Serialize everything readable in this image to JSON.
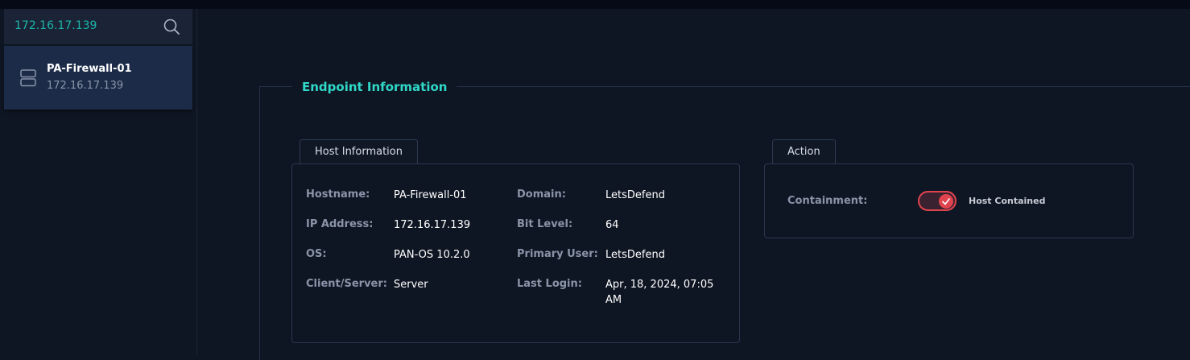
{
  "search": {
    "value": "172.16.17.139",
    "icon": "search-icon"
  },
  "host_list": [
    {
      "name": "PA-Firewall-01",
      "ip": "172.16.17.139",
      "icon": "server-icon"
    }
  ],
  "endpoint": {
    "title": "Endpoint Information",
    "host_info": {
      "tab_label": "Host Information",
      "fields": {
        "hostname": {
          "label": "Hostname:",
          "value": "PA-Firewall-01"
        },
        "ip": {
          "label": "IP Address:",
          "value": "172.16.17.139"
        },
        "os": {
          "label": "OS:",
          "value": "PAN-OS 10.2.0"
        },
        "client_server": {
          "label": "Client/Server:",
          "value": "Server"
        },
        "domain": {
          "label": "Domain:",
          "value": "LetsDefend"
        },
        "bit_level": {
          "label": "Bit Level:",
          "value": "64"
        },
        "primary_user": {
          "label": "Primary User:",
          "value": "LetsDefend"
        },
        "last_login": {
          "label": "Last Login:",
          "value": "Apr, 18, 2024, 07:05 AM"
        }
      }
    },
    "action": {
      "tab_label": "Action",
      "containment_label": "Containment:",
      "toggle_on": true,
      "toggle_text": "Host Contained"
    }
  },
  "colors": {
    "accent": "#2fd8c8",
    "search_text": "#1eb5a8",
    "toggle": "#e0444f",
    "background": "#0f1623",
    "selected_item": "#1c2c48"
  }
}
